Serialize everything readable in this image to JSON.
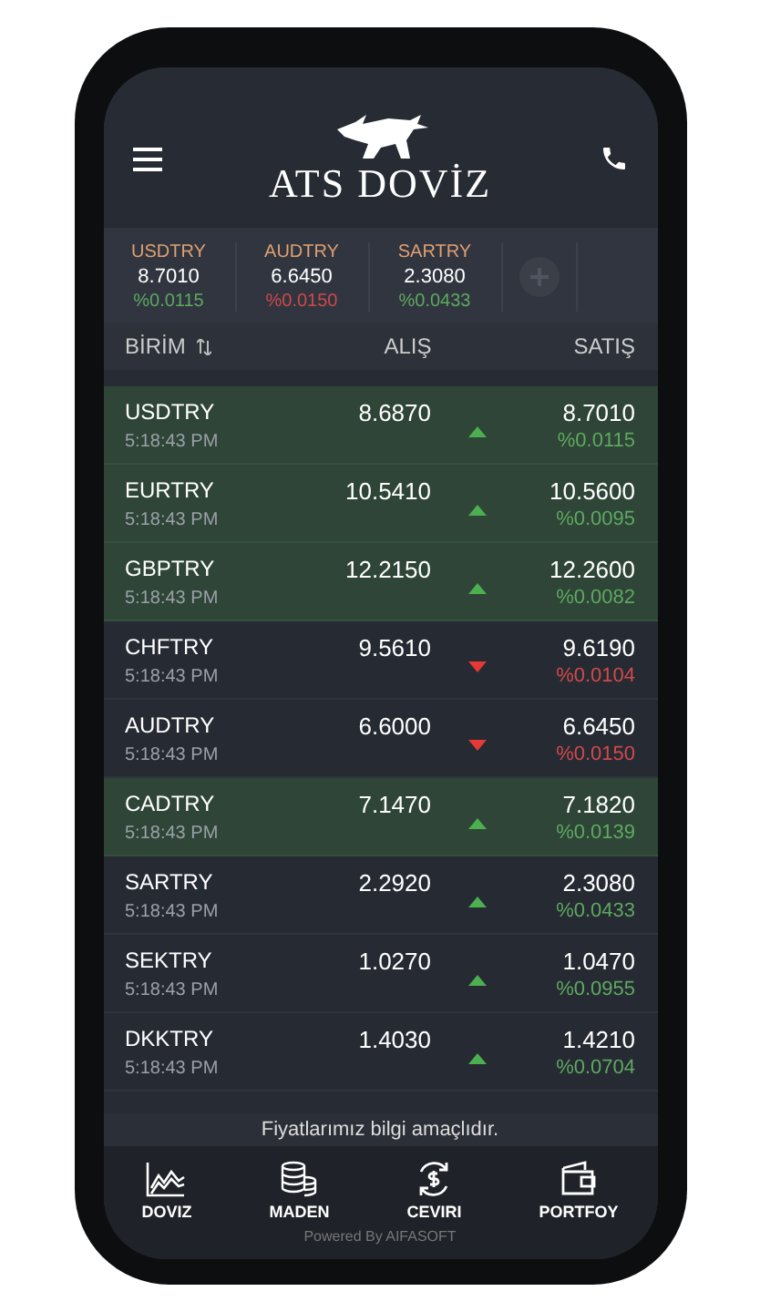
{
  "header": {
    "logo_text": "ATS DOVİZ"
  },
  "tickers": [
    {
      "symbol": "USDTRY",
      "price": "8.7010",
      "change": "%0.0115",
      "kind": "up"
    },
    {
      "symbol": "AUDTRY",
      "price": "6.6450",
      "change": "%0.0150",
      "kind": "down"
    },
    {
      "symbol": "SARTRY",
      "price": "2.3080",
      "change": "%0.0433",
      "kind": "up"
    }
  ],
  "table": {
    "columns": [
      "BİRİM",
      "ALIŞ",
      "SATIŞ"
    ],
    "rows": [
      {
        "symbol": "USDTRY",
        "time": "5:18:43 PM",
        "bid": "8.6870",
        "ask": "8.7010",
        "change": "%0.0115",
        "kind": "up",
        "highlighted": true
      },
      {
        "symbol": "EURTRY",
        "time": "5:18:43 PM",
        "bid": "10.5410",
        "ask": "10.5600",
        "change": "%0.0095",
        "kind": "up",
        "highlighted": true
      },
      {
        "symbol": "GBPTRY",
        "time": "5:18:43 PM",
        "bid": "12.2150",
        "ask": "12.2600",
        "change": "%0.0082",
        "kind": "up",
        "highlighted": true
      },
      {
        "symbol": "CHFTRY",
        "time": "5:18:43 PM",
        "bid": "9.5610",
        "ask": "9.6190",
        "change": "%0.0104",
        "kind": "down",
        "highlighted": false
      },
      {
        "symbol": "AUDTRY",
        "time": "5:18:43 PM",
        "bid": "6.6000",
        "ask": "6.6450",
        "change": "%0.0150",
        "kind": "down",
        "highlighted": false
      },
      {
        "symbol": "CADTRY",
        "time": "5:18:43 PM",
        "bid": "7.1470",
        "ask": "7.1820",
        "change": "%0.0139",
        "kind": "up",
        "highlighted": true
      },
      {
        "symbol": "SARTRY",
        "time": "5:18:43 PM",
        "bid": "2.2920",
        "ask": "2.3080",
        "change": "%0.0433",
        "kind": "up",
        "highlighted": false
      },
      {
        "symbol": "SEKTRY",
        "time": "5:18:43 PM",
        "bid": "1.0270",
        "ask": "1.0470",
        "change": "%0.0955",
        "kind": "up",
        "highlighted": false
      },
      {
        "symbol": "DKKTRY",
        "time": "5:18:43 PM",
        "bid": "1.4030",
        "ask": "1.4210",
        "change": "%0.0704",
        "kind": "up",
        "highlighted": false
      }
    ]
  },
  "notice": "Fiyatlarımız bilgi amaçlıdır.",
  "nav": [
    {
      "label": "DOVIZ"
    },
    {
      "label": "MADEN"
    },
    {
      "label": "CEVIRI"
    },
    {
      "label": "PORTFOY"
    }
  ],
  "footer": "Powered By AIFASOFT"
}
